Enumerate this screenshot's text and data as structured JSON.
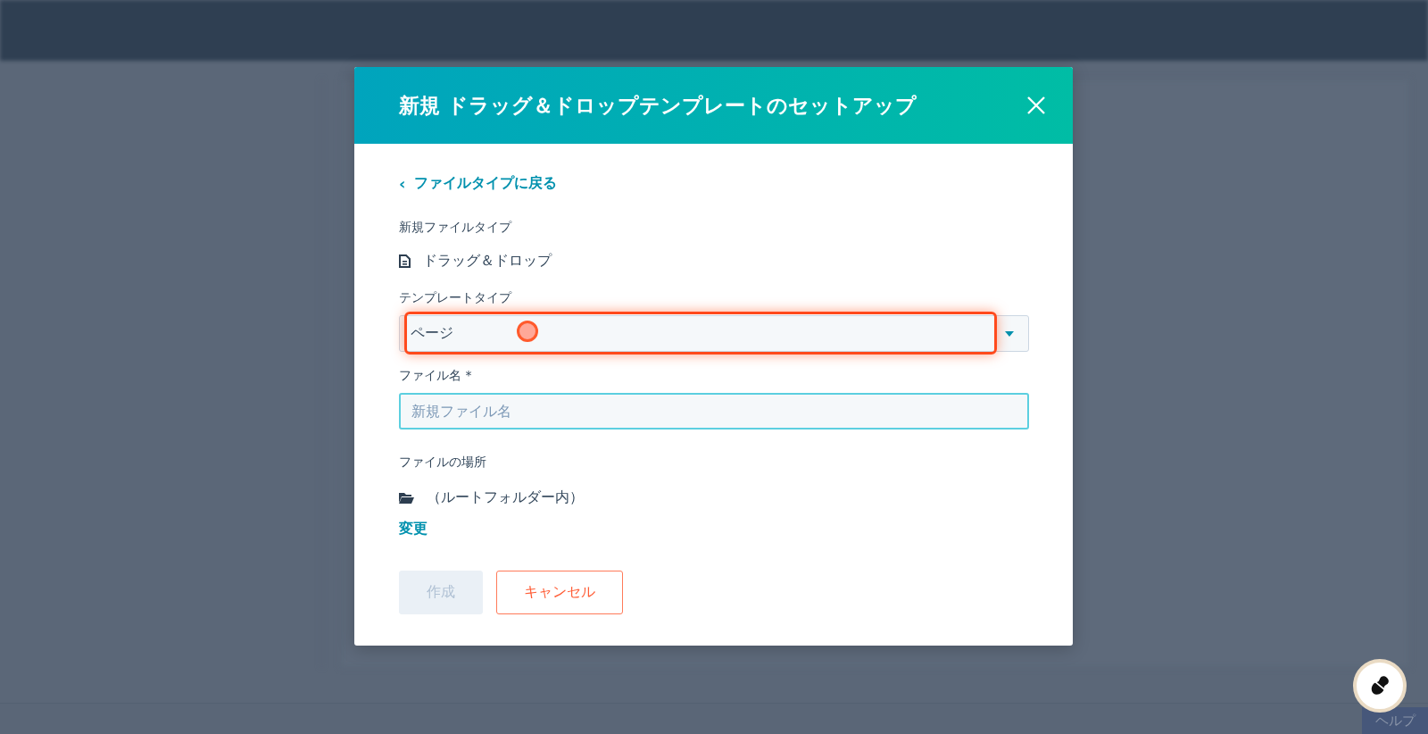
{
  "dialog": {
    "title": "新規 ドラッグ＆ドロップテンプレートのセットアップ",
    "back_link": {
      "icon": "‹",
      "label": "ファイルタイプに戻る"
    },
    "file_type": {
      "label": "新規ファイルタイプ",
      "value": "ドラッグ＆ドロップ"
    },
    "template_type": {
      "label": "テンプレートタイプ",
      "value": "ページ",
      "highlighted": true
    },
    "file_name": {
      "label": "ファイル名 *",
      "placeholder": "新規ファイル名"
    },
    "location": {
      "label": "ファイルの場所",
      "value": "（ルートフォルダー内）",
      "change_link": "変更"
    },
    "buttons": [
      {
        "label": "作成",
        "kind": "primary",
        "disabled": true
      },
      {
        "label": "キャンセル",
        "kind": "secondary",
        "disabled": false
      }
    ]
  },
  "help_tab": {
    "label": "ヘルプ"
  }
}
